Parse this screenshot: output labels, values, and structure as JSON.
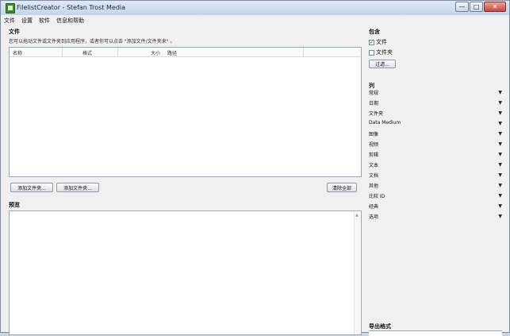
{
  "window": {
    "title": "FilelistCreator - Stefan Trost Media",
    "controls": {
      "minimize": "—",
      "maximize": "□",
      "close": "✕"
    }
  },
  "menu": [
    "文件",
    "设置",
    "软件",
    "信息和帮助"
  ],
  "files": {
    "title": "文件",
    "hint": "您可以拖动文件或文件夹到应用程序，或者你可以点击 \"添加文件/文件夹来\" 。",
    "columns": [
      "名称",
      "格式",
      "大小",
      "路径"
    ]
  },
  "buttons": {
    "add_folder": "添加文件夹...",
    "add_files": "添加文件夹...",
    "remove_all": "清除全部"
  },
  "preview": {
    "title": "预览"
  },
  "include": {
    "title": "包含",
    "options": [
      {
        "label": "文件",
        "checked": true
      },
      {
        "label": "文件夹",
        "checked": false
      }
    ],
    "filter_button": "过滤..."
  },
  "columns_panel": {
    "title": "列",
    "items": [
      "常规",
      "日期",
      "文件夹",
      "Data Medium",
      "图像",
      "视频",
      "剪辑",
      "文本",
      "文档",
      "其他",
      "比较 ID",
      "经典",
      "选项"
    ],
    "arrow": "▼"
  },
  "export": {
    "title": "导出格式"
  }
}
